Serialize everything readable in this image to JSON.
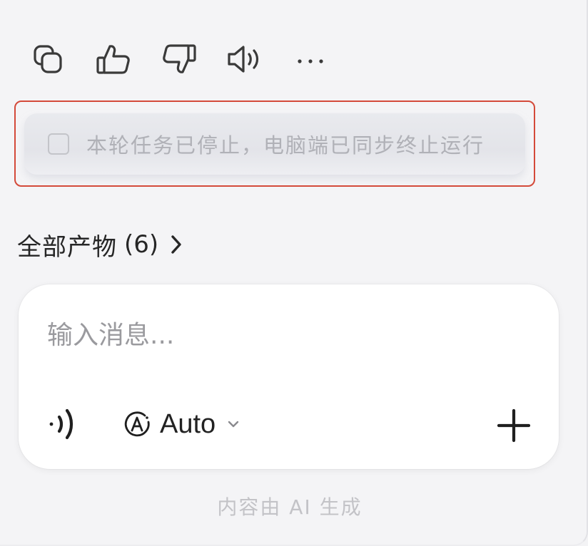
{
  "toolbar": {
    "actions": [
      {
        "icon": "copy-icon"
      },
      {
        "icon": "thumbs-up-icon"
      },
      {
        "icon": "thumbs-down-icon"
      },
      {
        "icon": "speaker-icon"
      },
      {
        "icon": "more-icon"
      }
    ]
  },
  "status": {
    "text": "本轮任务已停止，电脑端已同步终止运行",
    "highlight_color": "#d44a3a"
  },
  "artifacts": {
    "label": "全部产物",
    "count": "(6)"
  },
  "composer": {
    "placeholder": "输入消息...",
    "mode_label": "Auto"
  },
  "footer": {
    "note": "内容由 AI 生成"
  }
}
